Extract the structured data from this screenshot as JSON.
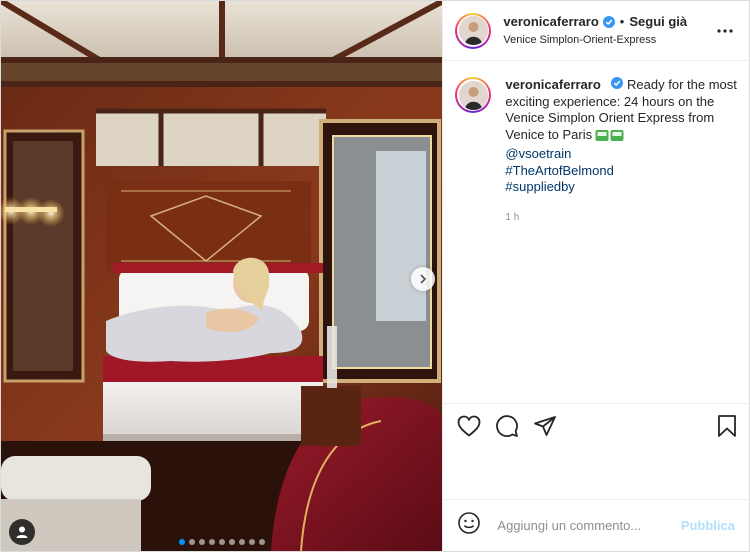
{
  "header": {
    "username": "veronicaferraro",
    "separator": "•",
    "follow_label": "Segui già",
    "location": "Venice Simplon-Orient-Express",
    "more_icon": "more-horizontal-icon"
  },
  "caption": {
    "username": "veronicaferraro",
    "text": "Ready for the most exciting experience: 24 hours on the Venice Simplon Orient Express from Venice to Paris",
    "emoji": "train-icon",
    "links": [
      "@vsoetrain",
      "#TheArtofBelmond",
      "#suppliedby"
    ],
    "time": "1 h"
  },
  "actions": {
    "like_icon": "heart-icon",
    "comment_icon": "comment-icon",
    "share_icon": "send-icon",
    "save_icon": "bookmark-icon"
  },
  "comment_box": {
    "placeholder": "Aggiungi un commento...",
    "publish_label": "Pubblica",
    "emoji_icon": "smiley-icon"
  },
  "carousel": {
    "slides": 9,
    "active_index": 0
  },
  "colors": {
    "verified": "#3897f0",
    "link": "#00376b",
    "publish_disabled": "#b2dffc",
    "carousel_active": "#0095f6"
  }
}
